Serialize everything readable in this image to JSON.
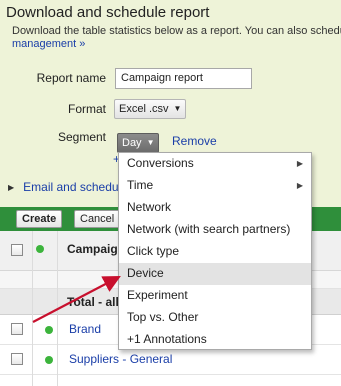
{
  "dialog": {
    "title": "Download and schedule report",
    "description": "Download the table statistics below as a report. You can also schedule",
    "description_link": "management »"
  },
  "form": {
    "report_name_label": "Report name",
    "report_name_value": "Campaign report",
    "format_label": "Format",
    "format_value": "Excel .csv",
    "segment_label": "Segment",
    "segment_value": "Day",
    "remove_label": "Remove",
    "add_label": "+"
  },
  "email": {
    "label": "Email and schedu"
  },
  "toolbar": {
    "create_label": "Create",
    "cancel_label": "Cancel"
  },
  "table": {
    "header_campaign": "Campaig",
    "total_label": "Total - all",
    "rows": [
      {
        "name": "Brand"
      },
      {
        "name": "Suppliers - General"
      }
    ]
  },
  "segment_menu": {
    "items": [
      {
        "label": "Conversions",
        "submenu": true
      },
      {
        "label": "Time",
        "submenu": true
      },
      {
        "label": "Network",
        "submenu": false
      },
      {
        "label": "Network (with search partners)",
        "submenu": false
      },
      {
        "label": "Click type",
        "submenu": false
      },
      {
        "label": "Device",
        "submenu": false,
        "highlighted": true
      },
      {
        "label": "Experiment",
        "submenu": false
      },
      {
        "label": "Top vs. Other",
        "submenu": false
      },
      {
        "label": "+1 Annotations",
        "submenu": false
      }
    ]
  },
  "colors": {
    "panel_bg": "#eef3d8",
    "toolbar_green": "#2f8f3b",
    "link_blue": "#1a3ea8",
    "status_green": "#3cb43c",
    "annotation_arrow": "#c8102e",
    "menu_highlight": "#e3e3e3"
  },
  "icons": {
    "dropdown": "triangle-down",
    "submenu": "triangle-right",
    "expand": "triangle-right",
    "status": "green-dot",
    "annotation": "red-arrow"
  }
}
